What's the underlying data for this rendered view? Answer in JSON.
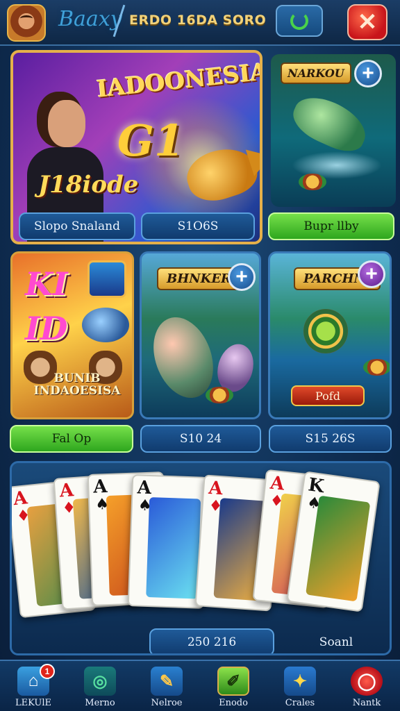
{
  "header": {
    "brand_script": "Baaxy",
    "title": "ERDO 16DA SORO",
    "icons": {
      "avatar": "avatar-icon",
      "refresh": "refresh-icon",
      "close": "close-icon"
    }
  },
  "hero": {
    "title": "IADOONESIA",
    "number": "G1",
    "subtitle": "J18iode",
    "btn_left": "Slopo Snaland",
    "btn_right": "S1O6S"
  },
  "top_right": {
    "banner": "NARKOU",
    "button": "Bupr llby"
  },
  "tile_k": {
    "letters_top": "KI",
    "letters_bottom": "ID",
    "caption_line1": "BUNIB",
    "caption_line2": "INDAOESISA",
    "button": "Fal Op"
  },
  "tile_bk": {
    "banner": "BHNKER",
    "button": "S10 24"
  },
  "tile_pc": {
    "banner": "PARCHNI",
    "pod": "Pofd",
    "button": "S15 26S"
  },
  "cards": {
    "items": [
      {
        "rank": "A",
        "suit": "♦",
        "color": "red"
      },
      {
        "rank": "A",
        "suit": "♦",
        "color": "red"
      },
      {
        "rank": "A",
        "suit": "♠",
        "color": "black"
      },
      {
        "rank": "A",
        "suit": "♠",
        "color": "black"
      },
      {
        "rank": "A",
        "suit": "♦",
        "color": "red"
      },
      {
        "rank": "A",
        "suit": "♦",
        "color": "red"
      },
      {
        "rank": "K",
        "suit": "♠",
        "color": "black"
      }
    ],
    "total": "250 216",
    "right_label": "Soanl"
  },
  "nav": {
    "items": [
      {
        "label": "LEKUlE",
        "icon": "home-icon",
        "badge": "1"
      },
      {
        "label": "Merno",
        "icon": "spiral-icon"
      },
      {
        "label": "Nelroe",
        "icon": "pencil-icon"
      },
      {
        "label": "Enodo",
        "icon": "edit-icon"
      },
      {
        "label": "Crales",
        "icon": "star-icon"
      },
      {
        "label": "Nantk",
        "icon": "power-icon"
      }
    ]
  },
  "colors": {
    "accent_gold": "#e5b04a",
    "button_blue": "#1f5a98",
    "button_green": "#2ea61e",
    "close_red": "#c8141a"
  }
}
